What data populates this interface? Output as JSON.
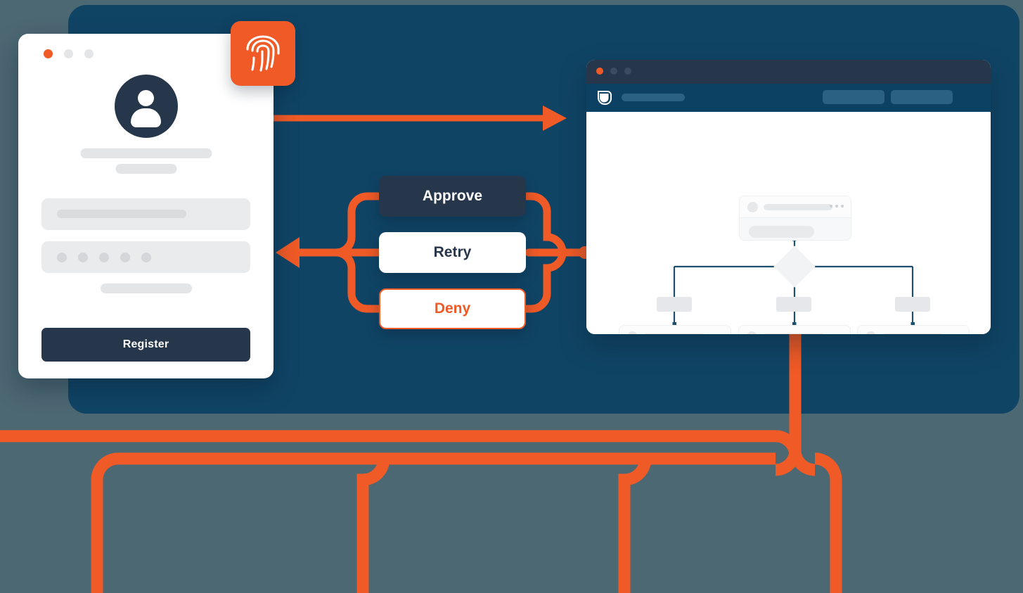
{
  "theme": {
    "page_background": "#4c6873",
    "panel_background": "#104465",
    "accent_orange": "#ef5a26",
    "dark_navy": "#27374b",
    "app_header_blue": "#0c4163",
    "placeholder_gray": "#e3e5e7",
    "card_white": "#ffffff"
  },
  "registration_card": {
    "window_dots": [
      "orange",
      "gray",
      "gray"
    ],
    "avatar_icon": "user-avatar-icon",
    "name_placeholder": "",
    "subtitle_placeholder": "",
    "fields": [
      {
        "type": "text",
        "placeholder": ""
      },
      {
        "type": "password",
        "dot_count": 5
      }
    ],
    "hint_placeholder": "",
    "submit_label": "Register"
  },
  "fingerprint_badge": {
    "icon": "fingerprint-icon",
    "background": "#ef5a26"
  },
  "decision_buttons": [
    {
      "label": "Approve",
      "style": "solid-dark",
      "background": "#27374b",
      "text_color": "#ffffff"
    },
    {
      "label": "Retry",
      "style": "solid-white",
      "background": "#ffffff",
      "text_color": "#27374b"
    },
    {
      "label": "Deny",
      "style": "outline-orange",
      "background": "#ffffff",
      "text_color": "#ef5a26",
      "border_color": "#ef5a26"
    }
  ],
  "browser_window": {
    "titlebar_dots": [
      "orange",
      "gray",
      "gray"
    ],
    "app_header": {
      "logo_icon": "shield-leaf-logo-icon",
      "title_placeholder": "",
      "buttons": [
        "",
        ""
      ]
    },
    "flowchart": {
      "root_card": {
        "avatar": "circle-avatar-icon",
        "title_placeholder": "",
        "menu_icon": "kebab-menu-icon",
        "body_placeholder": ""
      },
      "decision_node": {
        "shape": "diamond",
        "label": ""
      },
      "branch_chips": [
        "",
        "",
        ""
      ],
      "leaf_cards": [
        {
          "avatar": "circle-avatar-icon",
          "title_placeholder": "",
          "menu_icon": "kebab-menu-icon",
          "body_placeholder": ""
        },
        {
          "avatar": "circle-avatar-icon",
          "title_placeholder": "",
          "menu_icon": "kebab-menu-icon",
          "body_placeholder": ""
        },
        {
          "avatar": "circle-avatar-icon",
          "title_placeholder": "",
          "menu_icon": "kebab-menu-icon",
          "body_placeholder": ""
        }
      ],
      "connector_color": "#1f4f6e"
    }
  },
  "connectors": {
    "top_arrow": {
      "from": "registration-card",
      "to": "browser-window",
      "direction": "right",
      "color": "#ef5a26"
    },
    "decision_return_arrow": {
      "from": "decision-buttons",
      "to": "registration-card",
      "direction": "left",
      "color": "#ef5a26"
    },
    "bottom_bus": {
      "from": "browser-window",
      "branches": 3,
      "color": "#ef5a26"
    }
  }
}
